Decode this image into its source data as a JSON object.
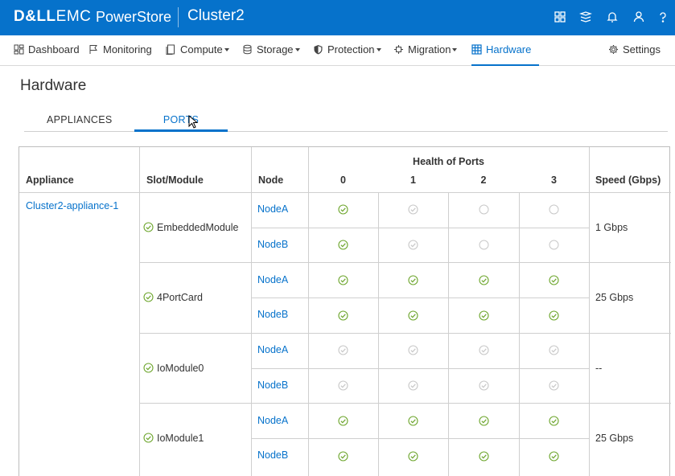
{
  "header": {
    "brand_bold": "D&LL",
    "brand_light": "EMC",
    "product": "PowerStore",
    "cluster": "Cluster2",
    "icons": [
      "grid-icon",
      "stack-icon",
      "bell-icon",
      "user-icon",
      "help-icon"
    ]
  },
  "nav": {
    "items": [
      {
        "label": "Dashboard",
        "icon": "dashboard-icon"
      },
      {
        "label": "Monitoring",
        "icon": "flag-icon"
      },
      {
        "label": "Compute",
        "icon": "compute-icon"
      },
      {
        "label": "Storage",
        "icon": "database-icon"
      },
      {
        "label": "Protection",
        "icon": "shield-icon"
      },
      {
        "label": "Migration",
        "icon": "migration-icon"
      },
      {
        "label": "Hardware",
        "icon": "hardware-icon"
      }
    ],
    "settings": "Settings",
    "accent": "#0672cb"
  },
  "page": {
    "title": "Hardware"
  },
  "tabs": [
    {
      "label": "APPLIANCES"
    },
    {
      "label": "PORTS"
    }
  ],
  "table": {
    "headers": {
      "appliance": "Appliance",
      "slot": "Slot/Module",
      "node": "Node",
      "health_group": "Health of Ports",
      "ports": [
        "0",
        "1",
        "2",
        "3"
      ],
      "speed": "Speed (Gbps)"
    },
    "appliance": "Cluster2-appliance-1",
    "modules": [
      {
        "name": "EmbeddedModule",
        "speed": "1 Gbps",
        "nodes": [
          {
            "name": "NodeA",
            "ports": [
              "ok",
              "ok-faded",
              "empty",
              "empty"
            ]
          },
          {
            "name": "NodeB",
            "ports": [
              "ok",
              "ok-faded",
              "empty",
              "empty"
            ]
          }
        ]
      },
      {
        "name": "4PortCard",
        "speed": "25 Gbps",
        "nodes": [
          {
            "name": "NodeA",
            "ports": [
              "ok",
              "ok",
              "ok",
              "ok"
            ]
          },
          {
            "name": "NodeB",
            "ports": [
              "ok",
              "ok",
              "ok",
              "ok"
            ]
          }
        ]
      },
      {
        "name": "IoModule0",
        "speed": "--",
        "nodes": [
          {
            "name": "NodeA",
            "ports": [
              "ok-faded",
              "ok-faded",
              "ok-faded",
              "ok-faded"
            ]
          },
          {
            "name": "NodeB",
            "ports": [
              "ok-faded",
              "ok-faded",
              "ok-faded",
              "ok-faded"
            ]
          }
        ]
      },
      {
        "name": "IoModule1",
        "speed": "25 Gbps",
        "nodes": [
          {
            "name": "NodeA",
            "ports": [
              "ok",
              "ok",
              "ok",
              "ok"
            ]
          },
          {
            "name": "NodeB",
            "ports": [
              "ok",
              "ok",
              "ok",
              "ok"
            ]
          }
        ]
      }
    ],
    "status_colors": {
      "ok": "#6ea62e",
      "faded": "#c8c8c8"
    }
  }
}
